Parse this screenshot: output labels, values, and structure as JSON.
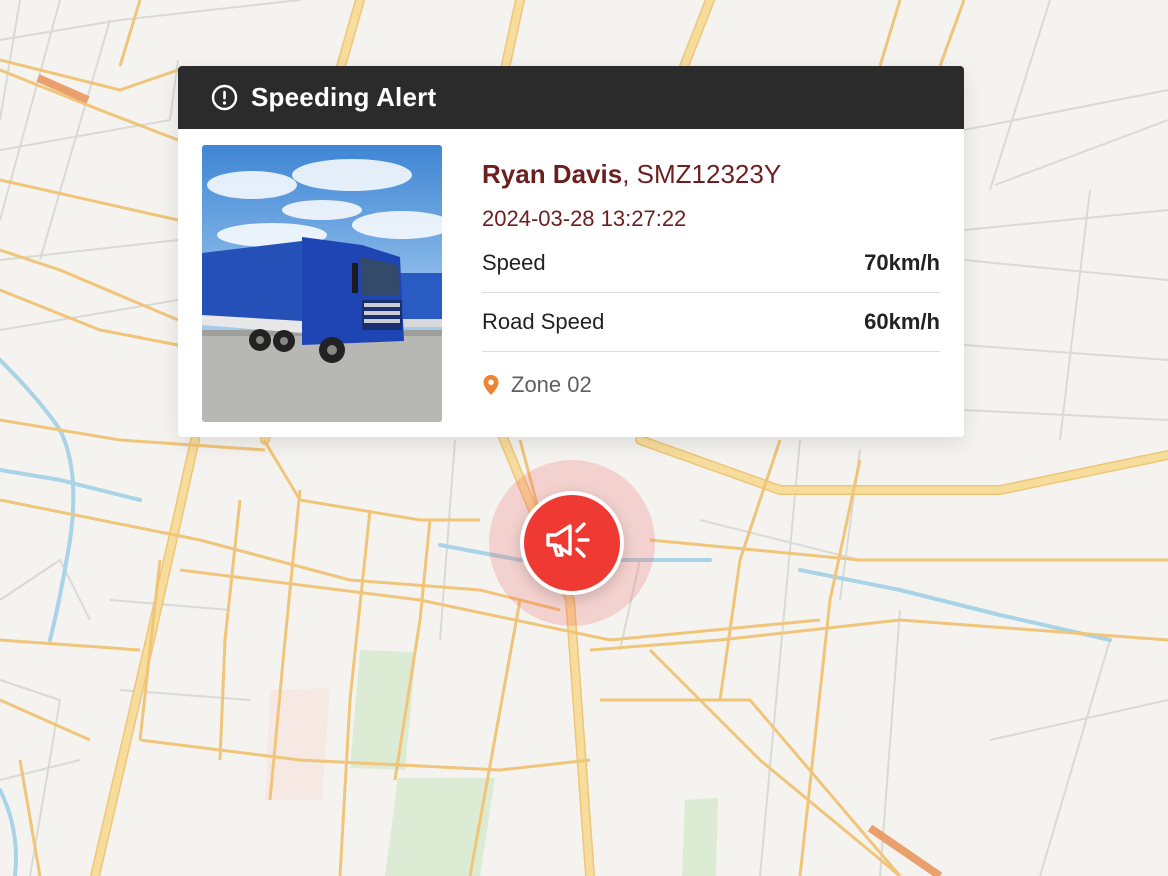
{
  "alert": {
    "title": "Speeding Alert",
    "header_icon": "exclamation-circle-icon"
  },
  "vehicle": {
    "driver_name": "Ryan Davis",
    "separator": ", ",
    "plate": "SMZ12323Y",
    "timestamp": "2024-03-28 13:27:22",
    "photo": "blue-semi-truck-photo"
  },
  "metrics": [
    {
      "label": "Speed",
      "value": "70km/h"
    },
    {
      "label": "Road Speed",
      "value": "60km/h"
    }
  ],
  "location": {
    "zone": "Zone 02",
    "icon": "location-pin-icon"
  },
  "marker": {
    "icon": "megaphone-icon"
  },
  "colors": {
    "header_bg": "#2b2b2b",
    "driver_text": "#6b1f1f",
    "marker_red": "#ee3a32",
    "pin_orange": "#ef8533",
    "road_major": "#f7dd9c",
    "road_edge": "#f0c57a",
    "map_bg": "#f4f3ef",
    "park": "#dcebd4",
    "water": "#a9d3e6"
  }
}
